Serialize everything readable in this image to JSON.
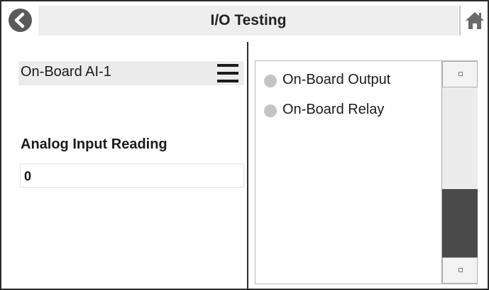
{
  "header": {
    "title": "I/O Testing",
    "back_icon": "chevron-left-icon",
    "home_icon": "home-icon"
  },
  "input_selector": {
    "selected": "On-Board AI-1",
    "menu_icon": "hamburger-menu-icon"
  },
  "reading": {
    "label": "Analog Input Reading",
    "value": "0"
  },
  "outputs": {
    "items": [
      {
        "label": "On-Board Output",
        "status_color": "#c4c4c4"
      },
      {
        "label": "On-Board Relay",
        "status_color": "#c4c4c4"
      }
    ]
  },
  "colors": {
    "header_band": "#eeeeee",
    "button_dark": "#5a5a5a",
    "scroll_thumb": "#4a4a4a"
  }
}
